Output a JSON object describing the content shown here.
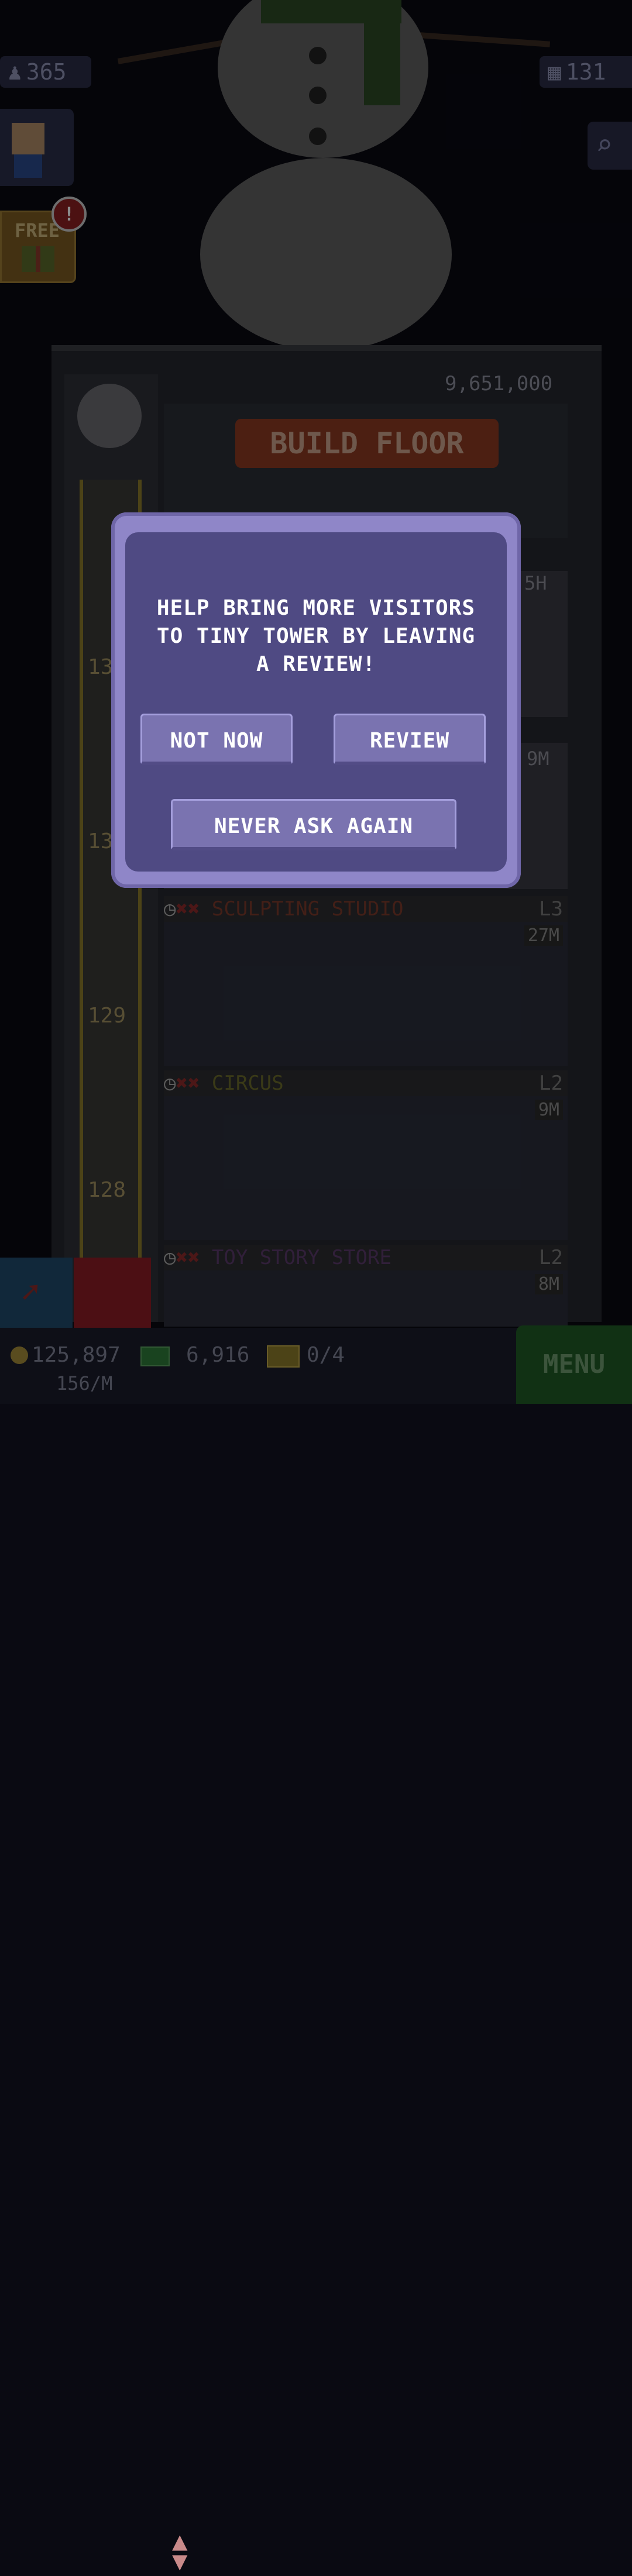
{
  "hud": {
    "population": "365",
    "floors": "131"
  },
  "free": {
    "label": "FREE",
    "badge": "!"
  },
  "tower": {
    "top_counter": "9,651,000",
    "build_floor": "BUILD FLOOR",
    "floors": [
      {
        "name": "SCULPTING STUDIO",
        "level": "L3",
        "price": "27M",
        "number": "129"
      },
      {
        "name": "CIRCUS",
        "level": "L2",
        "price": "9M",
        "number": "128"
      },
      {
        "name": "TOY STORY STORE",
        "level": "L2",
        "price": "8M",
        "number": ""
      }
    ],
    "partial_labels": [
      "5H",
      "9M",
      "13",
      "13"
    ]
  },
  "bottom": {
    "coins": "125,897",
    "coins_rate": "156/M",
    "bux": "6,916",
    "tickets": "0/4",
    "menu": "MENU"
  },
  "modal": {
    "message": "HELP BRING MORE VISITORS TO TINY TOWER BY LEAVING A REVIEW!",
    "not_now": "NOT NOW",
    "review": "REVIEW",
    "never_ask": "NEVER ASK AGAIN"
  },
  "colors": {
    "modal_border": "#8f86c8",
    "modal_fill": "#4f4a83",
    "button_fill": "#7a73b0",
    "menu_green": "#1f5a26"
  }
}
